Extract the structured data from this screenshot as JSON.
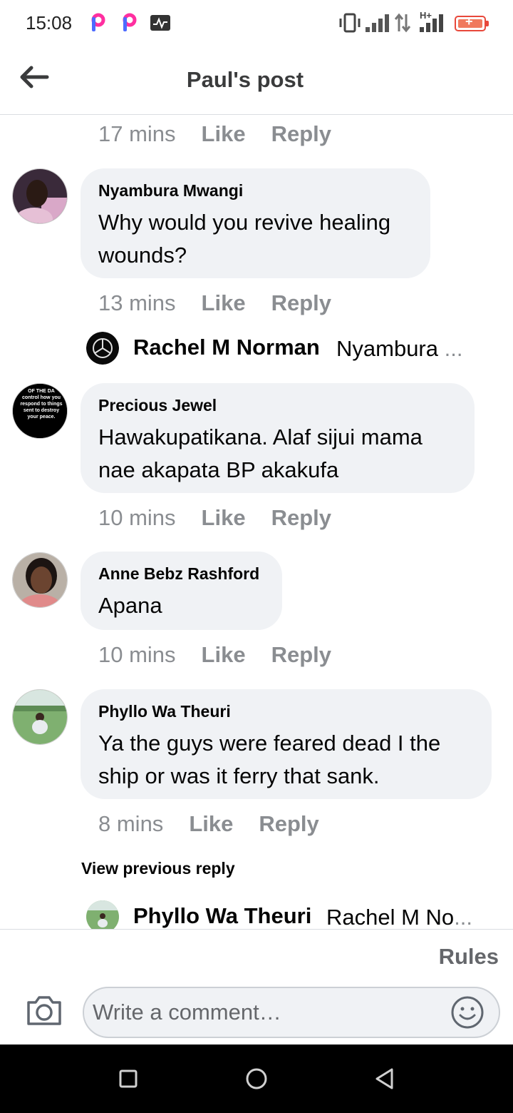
{
  "status_bar": {
    "time": "15:08",
    "network_label": "H+",
    "icons": [
      "picsart-icon",
      "picsart-icon",
      "activity-icon",
      "vibrate-icon",
      "signal-icon",
      "data-transfer-icon",
      "signal-icon",
      "battery-charging-icon"
    ],
    "battery_color": "#e8483b"
  },
  "header": {
    "title": "Paul's post",
    "back_icon": "arrow-left-icon"
  },
  "actions": {
    "like": "Like",
    "reply": "Reply"
  },
  "top_meta": {
    "time": "17 mins"
  },
  "comments": [
    {
      "name": "Nyambura Mwangi",
      "text": "Why would you revive healing wounds?",
      "time": "13 mins",
      "reply_preview": {
        "name": "Rachel M Norman",
        "snippet": "Nyambura",
        "ellipsis": "..."
      }
    },
    {
      "name": "Precious Jewel",
      "text": "Hawakupatikana. Alaf sijui mama nae akapata BP akakufa",
      "time": "10 mins",
      "avatar_text": "OF THE DA control how you respond to things sent to destroy your peace."
    },
    {
      "name": "Anne Bebz Rashford",
      "text": "Apana",
      "time": "10 mins"
    },
    {
      "name": "Phyllo Wa Theuri",
      "text": "Ya the guys were feared dead I  the ship or was it ferry that sank.",
      "time": "8 mins",
      "view_previous": "View previous reply",
      "reply_preview": {
        "name": "Phyllo Wa Theuri",
        "snippet": "Rachel M No",
        "ellipsis": "..."
      }
    }
  ],
  "composer": {
    "rules": "Rules",
    "placeholder": "Write a comment…",
    "camera_icon": "camera-icon",
    "emoji_icon": "smiley-icon"
  },
  "nav_bar": {
    "buttons": [
      "recents-icon",
      "home-icon",
      "back-icon"
    ]
  },
  "colors": {
    "bubble": "#f0f2f5",
    "secondary_text": "#8a8d91",
    "divider": "#dadde1"
  }
}
